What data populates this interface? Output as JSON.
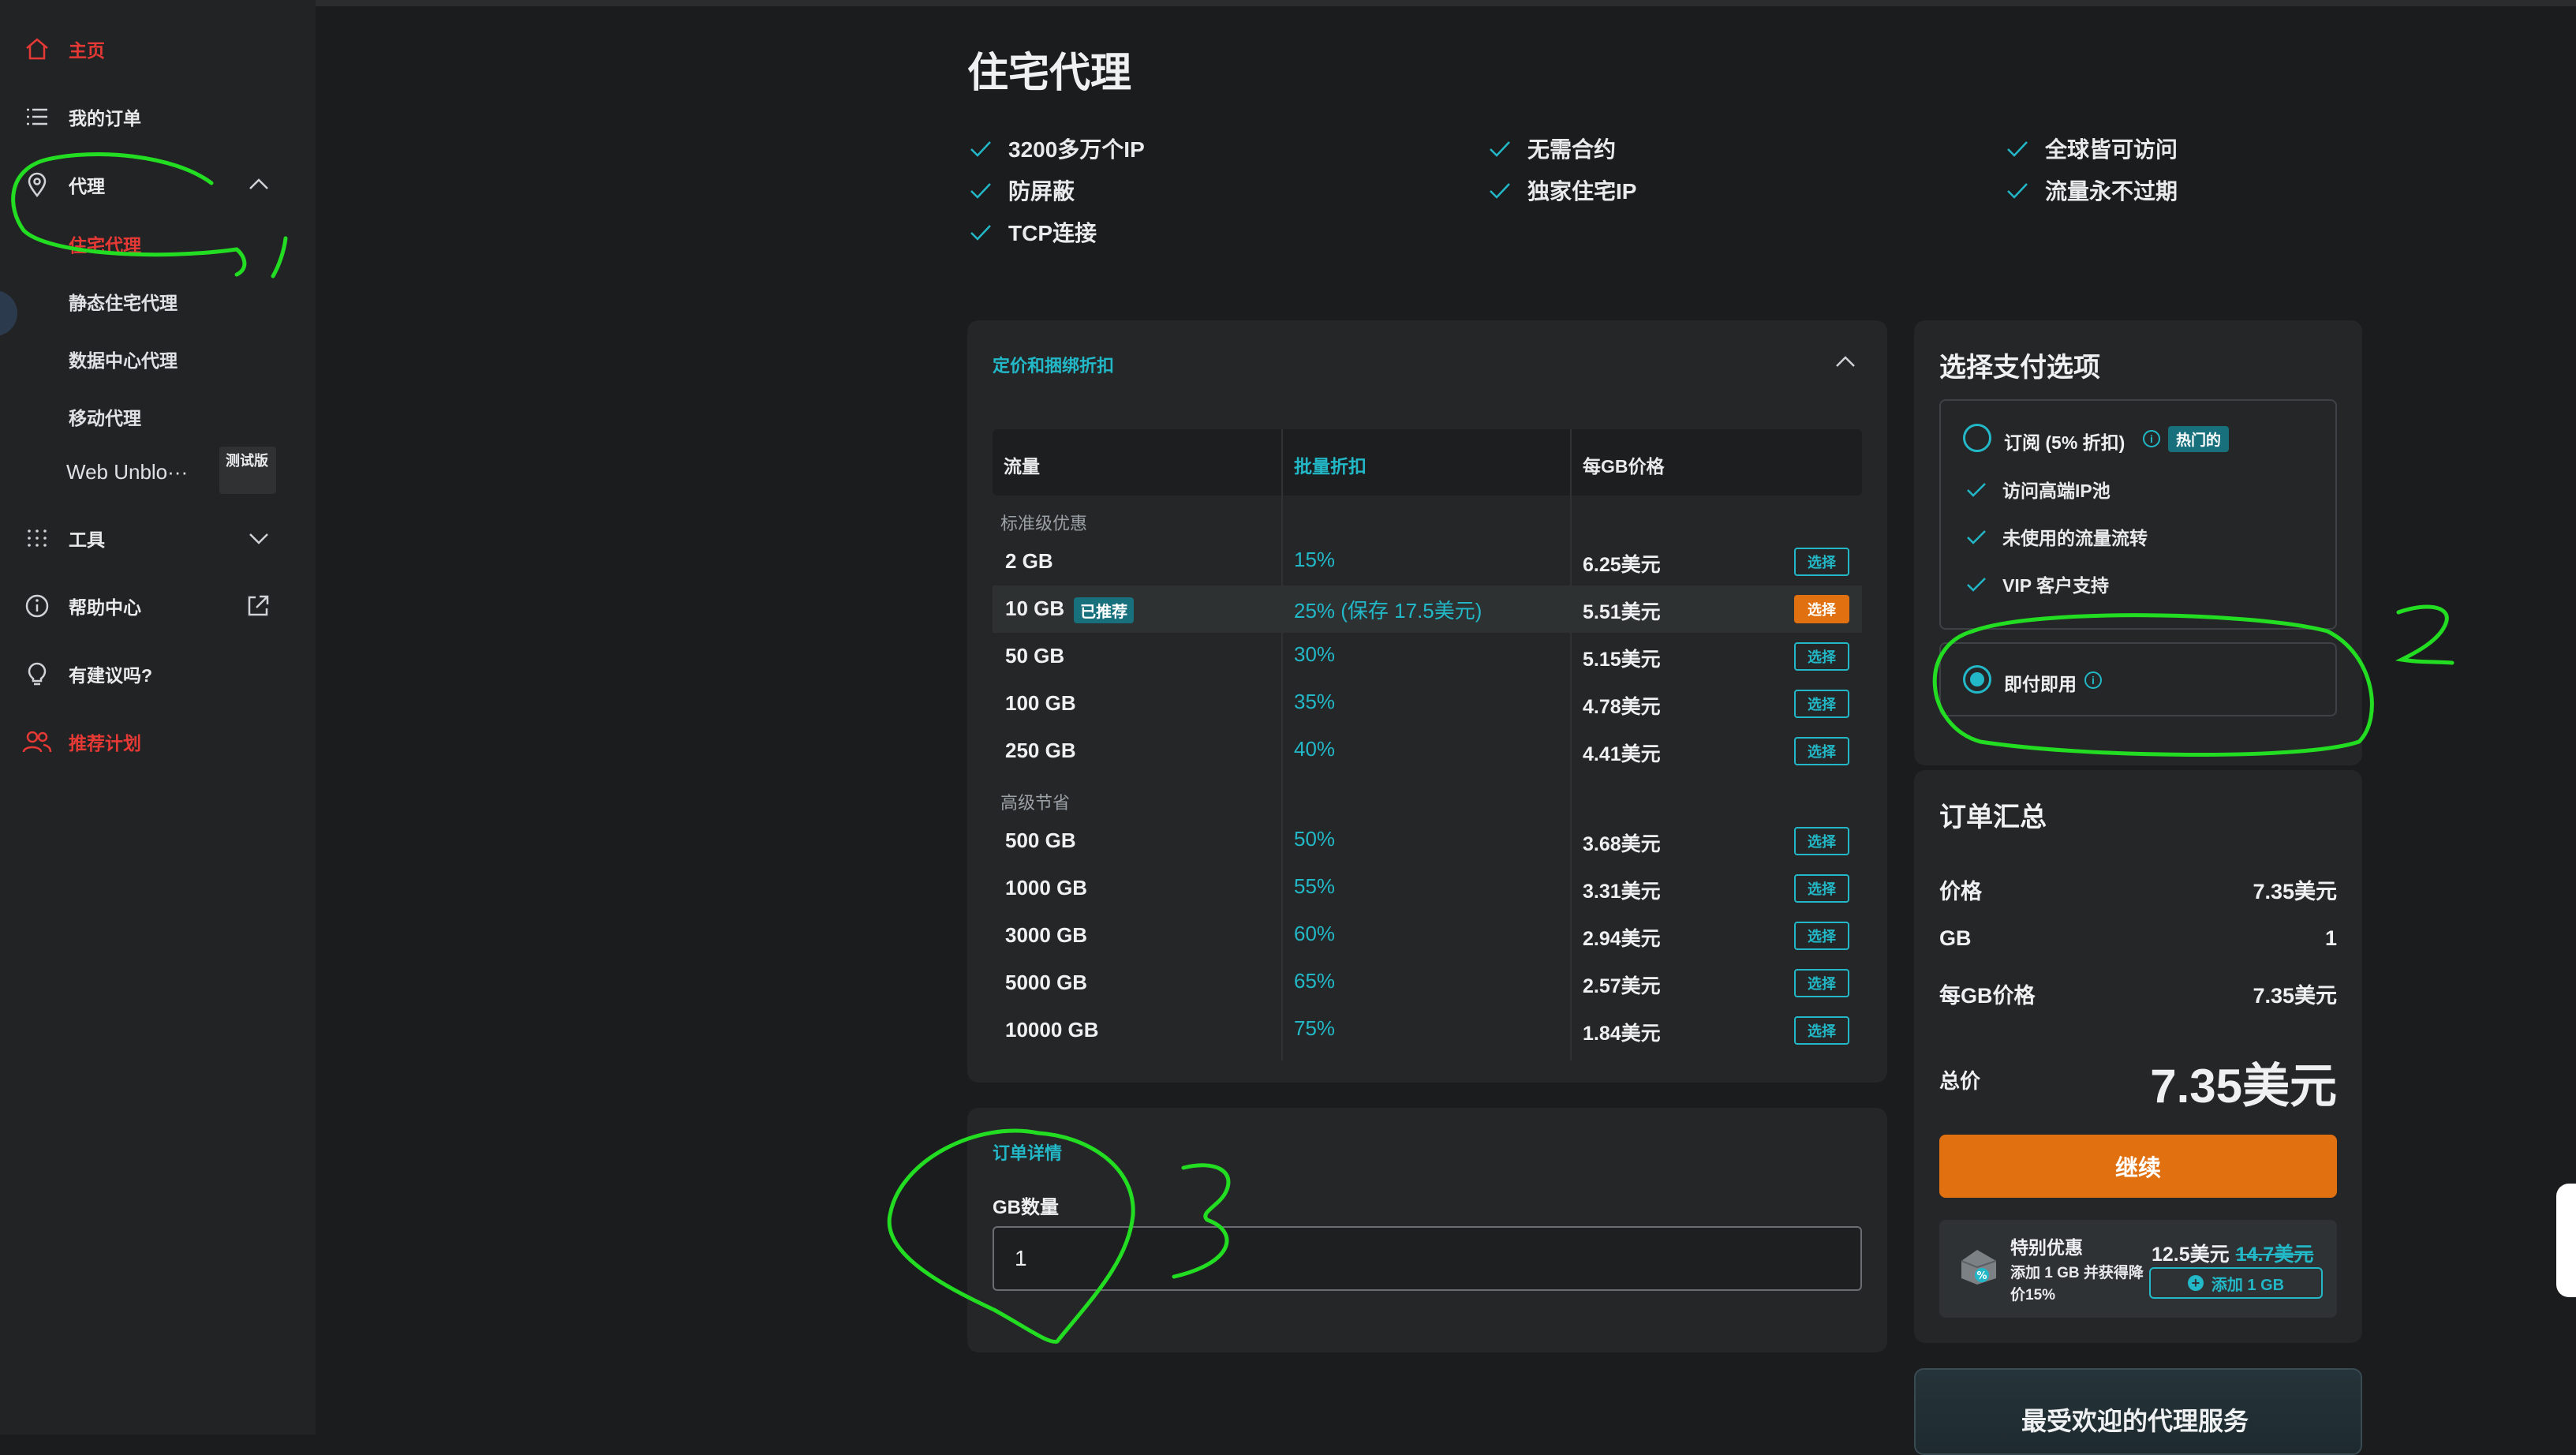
{
  "sidebar": {
    "home": "主页",
    "orders": "我的订单",
    "proxy": "代理",
    "proxy_sub": [
      "住宅代理",
      "静态住宅代理",
      "数据中心代理",
      "移动代理",
      "Web Unblo···"
    ],
    "beta_badge": "测试版",
    "tools": "工具",
    "help": "帮助中心",
    "feedback": "有建议吗?",
    "referral": "推荐计划"
  },
  "page": {
    "title": "住宅代理",
    "features": [
      "3200多万个IP",
      "无需合约",
      "全球皆可访问",
      "防屏蔽",
      "独家住宅IP",
      "流量永不过期",
      "TCP连接"
    ]
  },
  "pricing": {
    "heading": "定价和捆绑折扣",
    "columns": [
      "流量",
      "批量折扣",
      "每GB价格"
    ],
    "select_label": "选择",
    "groups": [
      "标准级优惠",
      "高级节省"
    ],
    "recommended_badge": "已推荐",
    "rows": [
      {
        "traffic": "2 GB",
        "discount": "15%",
        "price": "6.25美元"
      },
      {
        "traffic": "10 GB",
        "discount": "25% (保存 17.5美元)",
        "price": "5.51美元"
      },
      {
        "traffic": "50 GB",
        "discount": "30%",
        "price": "5.15美元"
      },
      {
        "traffic": "100 GB",
        "discount": "35%",
        "price": "4.78美元"
      },
      {
        "traffic": "250 GB",
        "discount": "40%",
        "price": "4.41美元"
      },
      {
        "traffic": "500 GB",
        "discount": "50%",
        "price": "3.68美元"
      },
      {
        "traffic": "1000 GB",
        "discount": "55%",
        "price": "3.31美元"
      },
      {
        "traffic": "3000 GB",
        "discount": "60%",
        "price": "2.94美元"
      },
      {
        "traffic": "5000 GB",
        "discount": "65%",
        "price": "2.57美元"
      },
      {
        "traffic": "10000 GB",
        "discount": "75%",
        "price": "1.84美元"
      }
    ]
  },
  "order_details": {
    "heading": "订单详情",
    "gb_label": "GB数量",
    "gb_value": "1"
  },
  "payment": {
    "title": "选择支付选项",
    "subscription": "订阅 (5% 折扣)",
    "hot_badge": "热门的",
    "perks": [
      "访问高端IP池",
      "未使用的流量流转",
      "VIP 客户支持"
    ],
    "payg": "即付即用"
  },
  "summary": {
    "title": "订单汇总",
    "price_label": "价格",
    "price_value": "7.35美元",
    "gb_label": "GB",
    "gb_value": "1",
    "per_gb_label": "每GB价格",
    "per_gb_value": "7.35美元",
    "total_label": "总价",
    "total_value": "7.35美元",
    "continue": "继续"
  },
  "promo": {
    "title": "特别优惠",
    "desc": "添加 1 GB 并获得降价15%",
    "price": "12.5美元",
    "old_price": "14.7美元",
    "button": "添加 1 GB"
  },
  "popular": {
    "title": "最受欢迎的代理服务"
  },
  "annotations": [
    "1",
    "2",
    "3"
  ],
  "colors": {
    "accent": "#22b8c8",
    "orange": "#e07010",
    "red": "#e53935",
    "annotation": "#22dd22"
  }
}
